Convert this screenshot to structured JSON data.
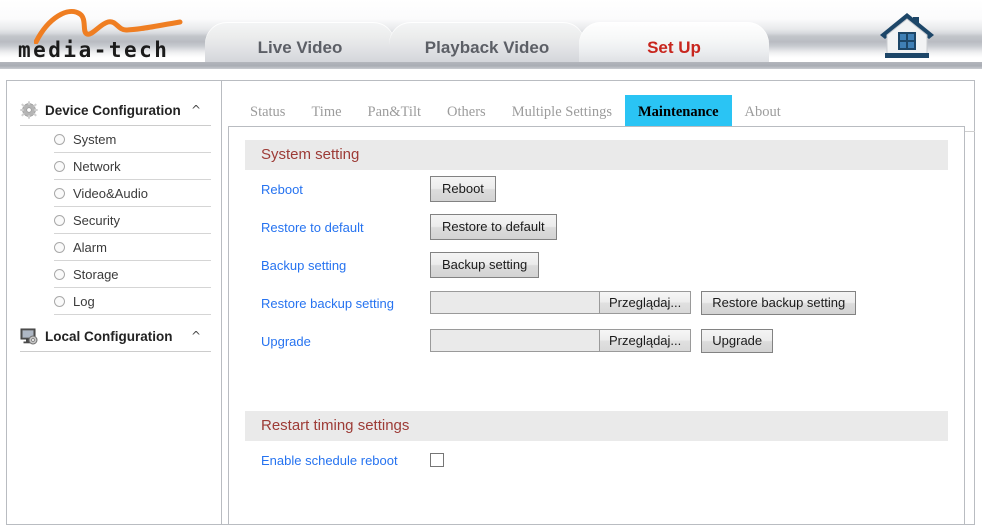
{
  "header": {
    "brand": "media-tech",
    "brand_icon": "swoosh-logo",
    "home_icon": "home-icon",
    "nav": [
      {
        "label": "Live Video",
        "active": false
      },
      {
        "label": "Playback Video",
        "active": false
      },
      {
        "label": "Set Up",
        "active": true
      }
    ],
    "active_color": "#c8261e"
  },
  "sidebar": {
    "groups": [
      {
        "label": "Device Configuration",
        "icon": "gear-icon",
        "chevron": "^",
        "items": [
          {
            "label": "System"
          },
          {
            "label": "Network"
          },
          {
            "label": "Video&Audio"
          },
          {
            "label": "Security"
          },
          {
            "label": "Alarm"
          },
          {
            "label": "Storage"
          },
          {
            "label": "Log"
          }
        ]
      },
      {
        "label": "Local Configuration",
        "icon": "monitor-gear-icon",
        "chevron": "^",
        "items": []
      }
    ]
  },
  "content": {
    "tabs": [
      {
        "label": "Status",
        "active": false
      },
      {
        "label": "Time",
        "active": false
      },
      {
        "label": "Pan&Tilt",
        "active": false
      },
      {
        "label": "Others",
        "active": false
      },
      {
        "label": "Multiple Settings",
        "active": false
      },
      {
        "label": "Maintenance",
        "active": true
      },
      {
        "label": "About",
        "active": false
      }
    ],
    "active_tab_color": "#2ac4f4",
    "sections": [
      {
        "title": "System setting",
        "rows": [
          {
            "label": "Reboot",
            "type": "button",
            "button": "Reboot"
          },
          {
            "label": "Restore to default",
            "type": "button",
            "button": "Restore to default"
          },
          {
            "label": "Backup setting",
            "type": "button",
            "button": "Backup setting"
          },
          {
            "label": "Restore backup setting",
            "type": "file",
            "file_value": "",
            "browse": "Przeglądaj...",
            "action": "Restore backup setting"
          },
          {
            "label": "Upgrade",
            "type": "file",
            "file_value": "",
            "browse": "Przeglądaj...",
            "action": "Upgrade"
          }
        ]
      },
      {
        "title": "Restart timing settings",
        "rows": [
          {
            "label": "Enable schedule reboot",
            "type": "checkbox",
            "checked": false
          }
        ]
      }
    ]
  }
}
